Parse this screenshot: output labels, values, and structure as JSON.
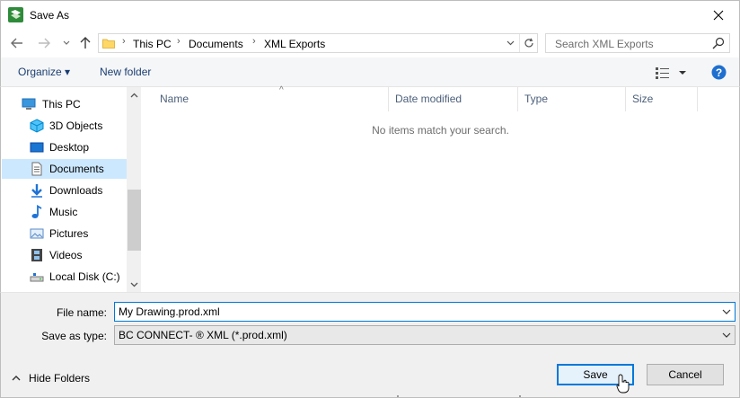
{
  "window": {
    "title": "Save As"
  },
  "address": {
    "crumbs": [
      "This PC",
      "Documents",
      "XML Exports"
    ]
  },
  "search": {
    "placeholder": "Search XML Exports"
  },
  "toolbar": {
    "organize_label": "Organize ▾",
    "new_folder_label": "New folder"
  },
  "sidebar": {
    "items": [
      {
        "label": "This PC",
        "icon": "computer-icon"
      },
      {
        "label": "3D Objects",
        "icon": "cube-icon"
      },
      {
        "label": "Desktop",
        "icon": "desktop-icon"
      },
      {
        "label": "Documents",
        "icon": "document-icon",
        "selected": true
      },
      {
        "label": "Downloads",
        "icon": "download-arrow-icon"
      },
      {
        "label": "Music",
        "icon": "music-note-icon"
      },
      {
        "label": "Pictures",
        "icon": "picture-icon"
      },
      {
        "label": "Videos",
        "icon": "film-icon"
      },
      {
        "label": "Local Disk (C:)",
        "icon": "drive-icon"
      }
    ]
  },
  "filelist": {
    "columns": [
      "Name",
      "Date modified",
      "Type",
      "Size"
    ],
    "empty_message": "No items match your search."
  },
  "save": {
    "file_name_label": "File name:",
    "file_name_value": "My Drawing.prod.xml",
    "type_label": "Save as type:",
    "type_value": "BC CONNECT- ® XML (*.prod.xml)",
    "hide_folders_label": "Hide Folders",
    "save_label": "Save",
    "cancel_label": "Cancel"
  },
  "colors": {
    "accent": "#0078d7",
    "selection": "#cce8ff",
    "help": "#1e6fd0"
  }
}
